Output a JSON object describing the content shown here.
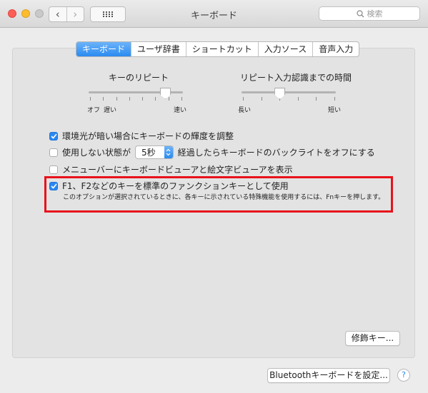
{
  "window": {
    "title": "キーボード",
    "search_placeholder": "検索"
  },
  "tabs": [
    {
      "label": "キーボード",
      "active": true
    },
    {
      "label": "ユーザ辞書",
      "active": false
    },
    {
      "label": "ショートカット",
      "active": false
    },
    {
      "label": "入力ソース",
      "active": false
    },
    {
      "label": "音声入力",
      "active": false
    }
  ],
  "key_repeat": {
    "title": "キーのリピート",
    "label_off": "オフ",
    "label_slow": "遅い",
    "label_fast": "速い",
    "value_fraction": 0.82
  },
  "repeat_delay": {
    "title": "リピート入力認識までの時間",
    "label_long": "長い",
    "label_short": "短い",
    "value_fraction": 0.4
  },
  "options": {
    "adjust_brightness": {
      "label": "環境光が暗い場合にキーボードの輝度を調整",
      "checked": true
    },
    "backlight_off": {
      "label_before": "使用しない状態が",
      "popup_value": "5秒",
      "label_after": "経過したらキーボードのバックライトをオフにする",
      "checked": false
    },
    "show_viewer": {
      "label": "メニューバーにキーボードビューアと絵文字ビューアを表示",
      "checked": false
    },
    "fn_keys": {
      "label": "F1、F2などのキーを標準のファンクションキーとして使用",
      "note": "このオプションが選択されているときに、各キーに示されている特殊機能を使用するには、Fnキーを押します。",
      "checked": true
    }
  },
  "buttons": {
    "modifier_keys": "修飾キー...",
    "bluetooth_setup": "Bluetoothキーボードを設定...",
    "help": "?"
  },
  "colors": {
    "accent": "#2a87f2",
    "highlight_box": "#e8121b"
  }
}
